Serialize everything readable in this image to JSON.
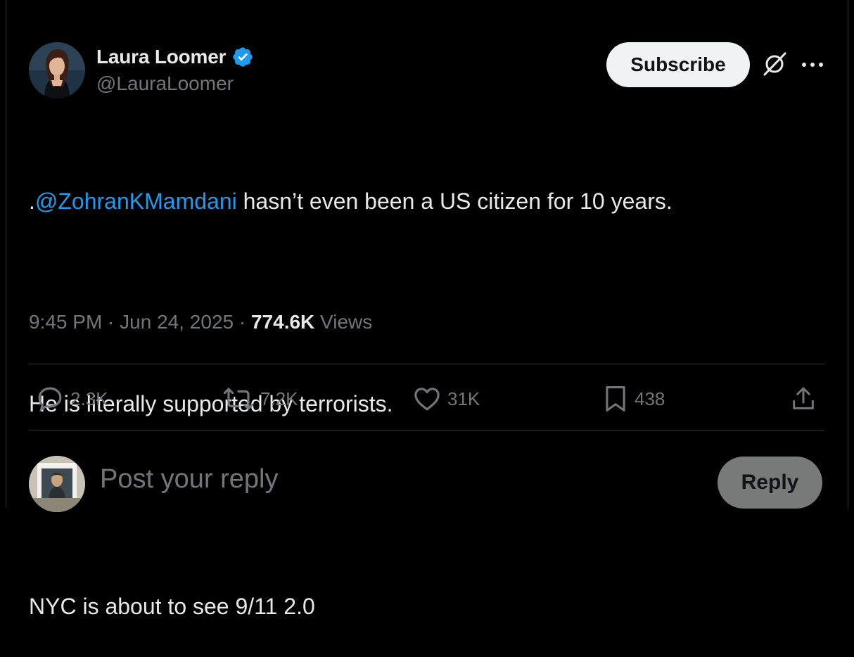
{
  "author": {
    "name": "Laura Loomer",
    "handle": "@LauraLoomer",
    "verified": true
  },
  "header": {
    "subscribe_label": "Subscribe",
    "icons": [
      "grok-icon",
      "more-icon"
    ]
  },
  "tweet": {
    "mention": "@ZohranKMamdani",
    "line1_prefix": ".",
    "line1_rest": " hasn’t even been a US citizen for 10 years.",
    "line2": "He is literally supported by terrorists.",
    "line3": "NYC is about to see 9/11 2.0"
  },
  "meta": {
    "time": "9:45 PM",
    "separator": " · ",
    "date": "Jun 24, 2025",
    "views_count": "774.6K",
    "views_label": " Views"
  },
  "actions": {
    "replies": "2.3K",
    "reposts": "7.2K",
    "likes": "31K",
    "bookmarks": "438"
  },
  "reply_bar": {
    "placeholder": "Post your reply",
    "button_label": "Reply"
  },
  "colors": {
    "background": "#000000",
    "text": "#e7e9ea",
    "muted": "#71767b",
    "accent": "#1d9bf0",
    "divider": "#2f3336"
  }
}
